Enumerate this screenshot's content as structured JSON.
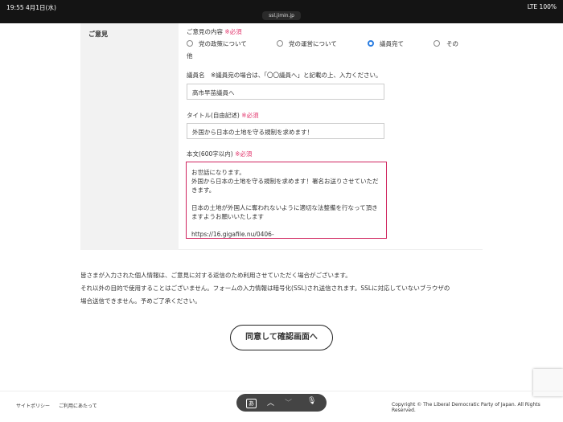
{
  "status": {
    "time": "19:55",
    "date": "4月1日(水)",
    "url": "ssl.jimin.jp",
    "signal": "LTE 100%"
  },
  "form": {
    "section_label": "ご意見",
    "content_label": "ご意見の内容",
    "required": "※必須",
    "radios": [
      {
        "label": "党の政策について",
        "checked": false
      },
      {
        "label": "党の運営について",
        "checked": false
      },
      {
        "label": "議員宛て",
        "checked": true
      },
      {
        "label": "その",
        "checked": false
      }
    ],
    "radio_wrap": "他",
    "member_label": "議員名　※議員宛の場合は、「〇〇議員へ」と記載の上、入力ください。",
    "member_value": "高市早苗議員へ",
    "title_label": "タイトル(自由記述)",
    "title_value": "外国から日本の土地を守る規制を求めます！",
    "body_label": "本文(600字以内)",
    "body_value": "お世話になります。\n外国から日本の土地を守る規制を求めます！署名お送りさせていただきます。\n\n日本の土地が外国人に奪われないように適切な法整備を行なって頂きますようお願いいたします\n\nhttps://16.gigafile.nu/0406-"
  },
  "notice": [
    "皆さまが入力された個人情報は、ご意見に対する返信のため利用させていただく場合がございます。",
    "それ以外の目的で使用することはございません。フォームの入力情報は暗号化(SSL)され送信されます。SSLに対応していないブラウザの",
    "場合送信できません。予めご了承ください。"
  ],
  "submit_label": "同意して確認画面へ",
  "footer": {
    "links": [
      "サイトポリシー",
      "ご利用にあたって"
    ],
    "copyright": "Copyright © The Liberal Democratic Party of Japan. All Rights Reserved."
  },
  "keyboard": {
    "key": "あ"
  }
}
